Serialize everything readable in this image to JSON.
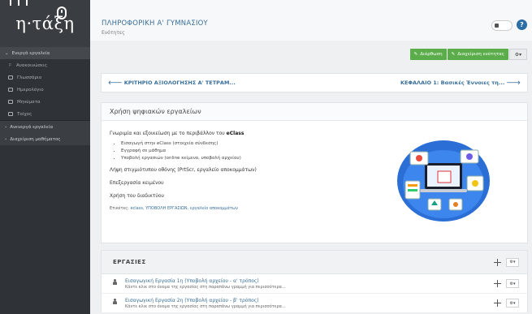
{
  "logo": {
    "text": "η·τάξη"
  },
  "sidebar": {
    "active_group": "Ενεργά εργαλεία",
    "items": [
      {
        "label": "Ανακοινώσεις",
        "icon": "megaphone-icon"
      },
      {
        "label": "Γλωσσάριο",
        "icon": "book-icon"
      },
      {
        "label": "Ημερολόγιο",
        "icon": "calendar-icon"
      },
      {
        "label": "Μηνύματα",
        "icon": "envelope-icon"
      },
      {
        "label": "Τοίχος",
        "icon": "wall-icon"
      }
    ],
    "groups": [
      "Ανενεργά εργαλεία",
      "Διαχείριση μαθήματος"
    ]
  },
  "header": {
    "course_title": "ΠΛΗΡΟΦΟΡΙΚΗ Α' ΓΥΜΝΑΣΙΟΥ",
    "course_sub": "Ενότητες",
    "help": "?"
  },
  "actions": {
    "edit_label": "Διόρθωση",
    "manage_label": "Διαχείριση ενότητας",
    "gear_label": "⚙▾"
  },
  "pager": {
    "prev": "ΚΡΙΤΗΡΙΟ ΑΞΙΟΛΟΓΗΣΗΣ Α' ΤΕΤΡΑΜ...",
    "next": "ΚΕΦΑΛΑΙΟ 1: Βασικές Έννοιες τη..."
  },
  "section": {
    "title": "Χρήση ψηφιακών εργαλείων",
    "intro_text": "Γνωριμία και εξοικείωση με το περιβάλλον του ",
    "intro_bold": "eClass",
    "bullets": [
      "Εισαγωγή στην eClass (στοιχεία σύνδεσης)",
      "Εγγραφή σε μάθημα",
      "Υποβολή εργασιών (online κείμενο, υποβολή αρχείου)"
    ],
    "lines": [
      "Λήψη στιγμιότυπου οθόνης (PrtScr, εργαλείο αποκομμάτων)",
      "Επεξεργασία κειμένου",
      "Χρήση του διαδικτύου"
    ],
    "tags_label": "Ετικέτες: ",
    "tags_value": "eclass, ΥΠΟΒΟΛΗ ΕΡΓΑΣΙΩΝ, εργαλείο αποκομμάτων"
  },
  "assignments": {
    "title": "ΕΡΓΑΣΙΕΣ",
    "items": [
      {
        "title": "Εισαγωγική Εργασία 1η (Υποβολή αρχείου - α' τρόπος)",
        "desc": "Κάντε κλικ στο όνομα της εργασίας στη παραπάνω γραμμή για περισσότερα..."
      },
      {
        "title": "Εισαγωγική Εργασία 2η (Υποβολή αρχείου - β' τρόπος)",
        "desc": "Κάντε κλικ στο όνομα της εργασίας στη παραπάνω γραμμή για περισσότερα..."
      }
    ]
  },
  "colors": {
    "sidebar": "#2f3236",
    "link": "#3a6f99",
    "green": "#5aad4a"
  }
}
